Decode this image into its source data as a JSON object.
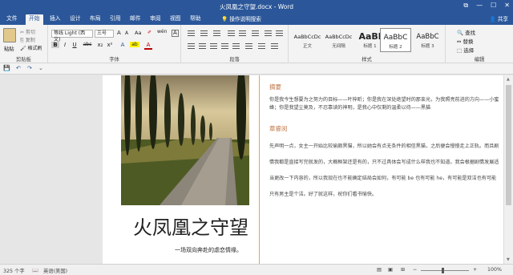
{
  "window": {
    "title": "火凤凰之守望.docx - Word",
    "min": "—",
    "max": "☐",
    "close": "✕",
    "restore": "⧉"
  },
  "tabs": [
    "文件",
    "开始",
    "插入",
    "设计",
    "布局",
    "引用",
    "邮件",
    "审阅",
    "视图",
    "帮助"
  ],
  "tell_me": "操作说明搜索",
  "share": "共享",
  "clipboard": {
    "paste": "粘贴",
    "cut": "剪切",
    "copy": "复制",
    "painter": "格式刷",
    "label": "剪贴板"
  },
  "font": {
    "name": "等线 Light (西文)",
    "size": "三号",
    "label": "字体",
    "bold": "B",
    "italic": "I",
    "underline": "U",
    "strike": "abc",
    "sub": "x₂",
    "sup": "x²",
    "color": "A",
    "highlight": "ab",
    "grow": "A",
    "shrink": "A",
    "clear": "Aa",
    "phonetic": "wén",
    "border": "A"
  },
  "paragraph": {
    "label": "段落"
  },
  "styles": {
    "label": "样式",
    "items": [
      {
        "sample": "AaBbCcDc",
        "name": "正文"
      },
      {
        "sample": "AaBbCcDc",
        "name": "无间隔"
      },
      {
        "sample": "AaBl",
        "name": "标题 1"
      },
      {
        "sample": "AaBbC",
        "name": "标题 2"
      },
      {
        "sample": "AaBbC",
        "name": "标题 3"
      }
    ]
  },
  "editing": {
    "find": "查找",
    "replace": "替换",
    "select": "选择",
    "label": "编辑"
  },
  "qat": {
    "save": "💾",
    "undo": "↶",
    "redo": "↷"
  },
  "doc": {
    "big_title": "火凤凰之守望",
    "subtitle": "一场双向奔赴的虐恋情缘。",
    "section1_title": "摘要",
    "section1_text": "你是我今生想要为之努力的目标——叶梓昕；你是我在深处绝望时的那束光，为我照亮前进的方向——小蜜蜂；你是我望尘莫及，不忍靠读的神明，是我心中仅剩的温柔以待——黑猫",
    "section2_title": "章睿闵",
    "section2_text": "先声明一点，女主一开始比较偷颇黑猫，所以她会有点无条件的相信黑猫，之后便会慢慢走上正轨。而且剧情我都是直接写完就发的，大概框架还是有的，只不过具体会写成什么样我也不知道。我会根据剧情发展适当更改一下内容的，所以我现在也不能确定结局会如何，有可能 be 也有可能 he，有可能是双洁也有可能只有男主是个洁。好了就这样，祝你们看书愉快。"
  },
  "status": {
    "words": "325 个字",
    "lang": "英语(美国)",
    "zoom": "100%",
    "zoom_minus": "−",
    "zoom_plus": "+"
  },
  "colors": {
    "brand": "#2b579a",
    "accent_orange": "#c0784a",
    "divider": "#e8a44a"
  }
}
